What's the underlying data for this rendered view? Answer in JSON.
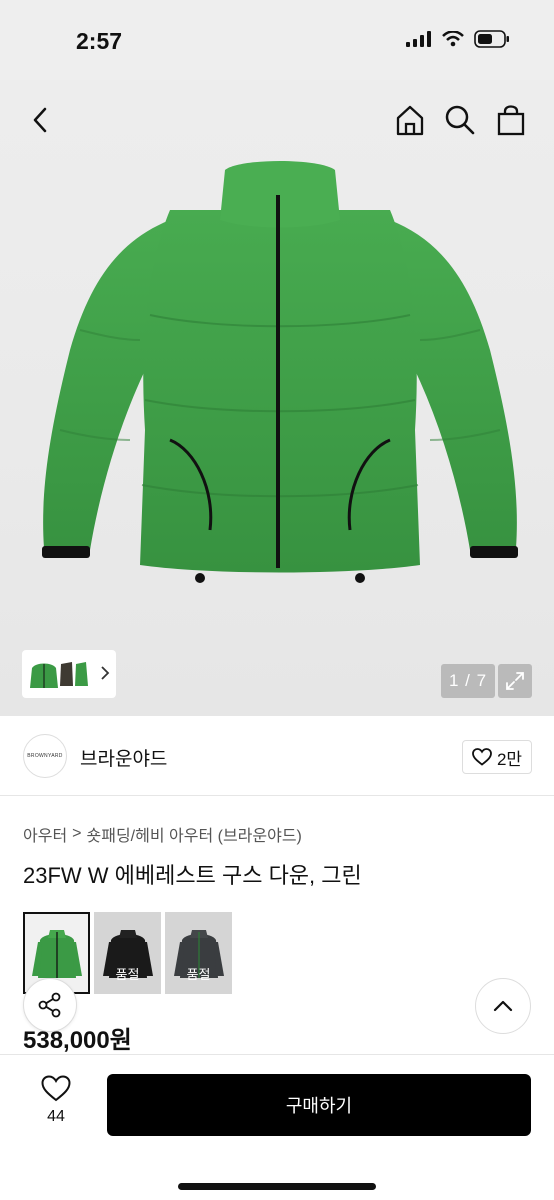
{
  "status_bar": {
    "time": "2:57"
  },
  "icons": {
    "back": "chevron-left-icon",
    "home": "home-icon",
    "search": "search-icon",
    "bag": "shopping-bag-icon",
    "expand": "expand-icon",
    "heart": "heart-icon",
    "share": "share-icon",
    "scroll_top": "chevron-up-icon"
  },
  "gallery": {
    "counter": "1 / 7"
  },
  "brand": {
    "logo_text": "BROWNYARD",
    "name": "브라운야드",
    "likes": "2만"
  },
  "breadcrumb": {
    "level1": "아우터",
    "separator": ">",
    "level2": "숏패딩/헤비 아우터 (브라운야드)"
  },
  "product": {
    "title": "23FW W 에베레스트 구스 다운, 그린",
    "price": "538,000원",
    "color_options": [
      {
        "color": "#3b9a45",
        "status": ""
      },
      {
        "color": "#1a1a1a",
        "status": "품절"
      },
      {
        "color": "#3a3d40",
        "status": "품절"
      }
    ]
  },
  "bottom_bar": {
    "wish_count": "44",
    "buy_label": "구매하기"
  },
  "colors": {
    "jacket_green": "#3b9a45",
    "button_black": "#000000"
  }
}
